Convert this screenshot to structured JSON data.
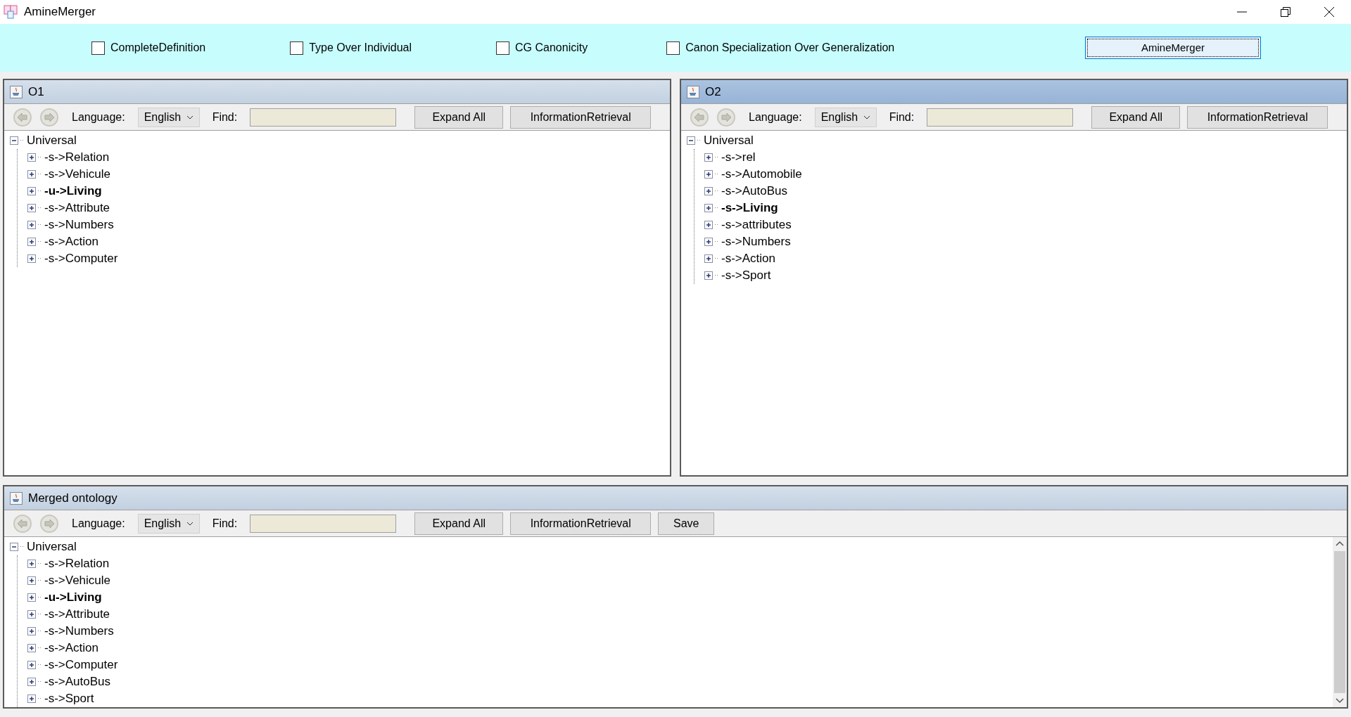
{
  "window": {
    "title": "AmineMerger"
  },
  "options": [
    {
      "label": "CompleteDefinition",
      "checked": false
    },
    {
      "label": "Type Over Individual",
      "checked": false
    },
    {
      "label": "CG Canonicity",
      "checked": false
    },
    {
      "label": "Canon Specialization Over Generalization",
      "checked": false
    }
  ],
  "merge_button": "AmineMerger",
  "panels": [
    {
      "title": "O1",
      "active": false,
      "language_label": "Language:",
      "language": "English",
      "find_label": "Find:",
      "buttons": [
        "Expand All",
        "InformationRetrieval"
      ],
      "tree": {
        "label": "Universal",
        "expanded": true,
        "children": [
          {
            "label": "-s->Relation",
            "bold": false,
            "expanded": false
          },
          {
            "label": "-s->Vehicule",
            "bold": false,
            "expanded": false
          },
          {
            "label": "-u->Living",
            "bold": true,
            "expanded": false
          },
          {
            "label": "-s->Attribute",
            "bold": false,
            "expanded": false
          },
          {
            "label": "-s->Numbers",
            "bold": false,
            "expanded": false
          },
          {
            "label": "-s->Action",
            "bold": false,
            "expanded": false
          },
          {
            "label": "-s->Computer",
            "bold": false,
            "expanded": false
          }
        ]
      }
    },
    {
      "title": "O2",
      "active": true,
      "language_label": "Language:",
      "language": "English",
      "find_label": "Find:",
      "buttons": [
        "Expand All",
        "InformationRetrieval"
      ],
      "tree": {
        "label": "Universal",
        "expanded": true,
        "children": [
          {
            "label": "-s->rel",
            "bold": false,
            "expanded": false
          },
          {
            "label": "-s->Automobile",
            "bold": false,
            "expanded": false
          },
          {
            "label": "-s->AutoBus",
            "bold": false,
            "expanded": false
          },
          {
            "label": "-s->Living",
            "bold": true,
            "expanded": false
          },
          {
            "label": "-s->attributes",
            "bold": false,
            "expanded": false
          },
          {
            "label": "-s->Numbers",
            "bold": false,
            "expanded": false
          },
          {
            "label": "-s->Action",
            "bold": false,
            "expanded": false
          },
          {
            "label": "-s->Sport",
            "bold": false,
            "expanded": false
          }
        ]
      }
    },
    {
      "title": "Merged ontology",
      "active": false,
      "language_label": "Language:",
      "language": "English",
      "find_label": "Find:",
      "buttons": [
        "Expand All",
        "InformationRetrieval",
        "Save"
      ],
      "scrollbar": true,
      "tree": {
        "label": "Universal",
        "expanded": true,
        "children": [
          {
            "label": "-s->Relation",
            "bold": false,
            "expanded": false
          },
          {
            "label": "-s->Vehicule",
            "bold": false,
            "expanded": false
          },
          {
            "label": "-u->Living",
            "bold": true,
            "expanded": false
          },
          {
            "label": "-s->Attribute",
            "bold": false,
            "expanded": false
          },
          {
            "label": "-s->Numbers",
            "bold": false,
            "expanded": false
          },
          {
            "label": "-s->Action",
            "bold": false,
            "expanded": false
          },
          {
            "label": "-s->Computer",
            "bold": false,
            "expanded": false
          },
          {
            "label": "-s->AutoBus",
            "bold": false,
            "expanded": false
          },
          {
            "label": "-s->Sport",
            "bold": false,
            "expanded": false
          }
        ]
      }
    }
  ]
}
